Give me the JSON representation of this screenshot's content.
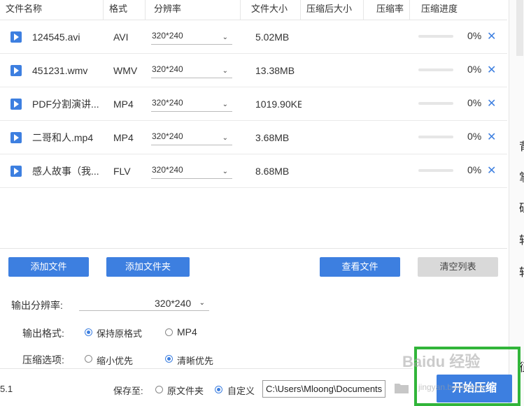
{
  "table": {
    "columns": [
      "文件名称",
      "格式",
      "分辨率",
      "文件大小",
      "压缩后大小",
      "压缩率",
      "压缩进度"
    ],
    "rows": [
      {
        "name": "124545.avi",
        "format": "AVI",
        "resolution": "320*240",
        "size": "5.02MB",
        "compressed": "",
        "ratio": "",
        "progress": "0%",
        "progress_value": 0
      },
      {
        "name": "451231.wmv",
        "format": "WMV",
        "resolution": "320*240",
        "size": "13.38MB",
        "compressed": "",
        "ratio": "",
        "progress": "0%",
        "progress_value": 0
      },
      {
        "name": "PDF分割演讲...",
        "format": "MP4",
        "resolution": "320*240",
        "size": "1019.90KE",
        "compressed": "",
        "ratio": "",
        "progress": "0%",
        "progress_value": 0
      },
      {
        "name": "二哥和人.mp4",
        "format": "MP4",
        "resolution": "320*240",
        "size": "3.68MB",
        "compressed": "",
        "ratio": "",
        "progress": "0%",
        "progress_value": 0
      },
      {
        "name": "感人故事（我...",
        "format": "FLV",
        "resolution": "320*240",
        "size": "8.68MB",
        "compressed": "",
        "ratio": "",
        "progress": "0%",
        "progress_value": 0
      }
    ]
  },
  "buttons": {
    "add_file": "添加文件",
    "add_folder": "添加文件夹",
    "view_files": "查看文件",
    "clear_list": "清空列表",
    "start": "开始压缩"
  },
  "options": {
    "output_resolution_label": "输出分辨率:",
    "output_resolution_value": "320*240",
    "output_format_label": "输出格式:",
    "format_keep": "保持原格式",
    "format_mp4": "MP4",
    "compress_label": "压缩选项:",
    "compress_small": "缩小优先",
    "compress_clear": "清晰优先"
  },
  "footer": {
    "version": "5.1",
    "save_to_label": "保存至:",
    "save_original": "原文件夹",
    "save_custom": "自定义",
    "path": "C:\\Users\\Mloong\\Documents"
  },
  "watermark": {
    "text": "Baidu 经验",
    "url": "jingyan.baidu.com"
  },
  "colors": {
    "accent": "#3d7fe0",
    "highlight_frame": "#31b53a"
  }
}
